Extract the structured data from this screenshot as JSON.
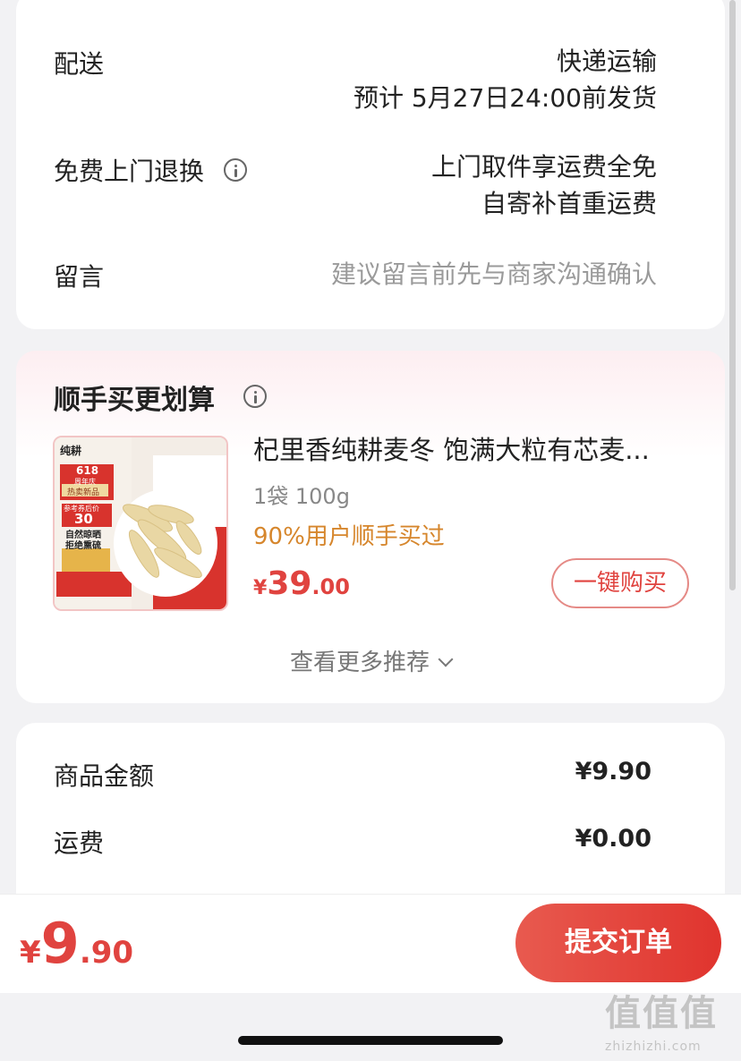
{
  "delivery": {
    "label": "配送",
    "method": "快递运输",
    "ship_time": "预计 5月27日24:00前发货"
  },
  "return_service": {
    "label": "免费上门退换",
    "line1": "上门取件享运费全免",
    "line2": "自寄补首重运费"
  },
  "message": {
    "label": "留言",
    "placeholder": "建议留言前先与商家沟通确认"
  },
  "recommend": {
    "title": "顺手买更划算",
    "product": {
      "name": "杞里香纯耕麦冬 饱满大粒有芯麦...",
      "spec": "1袋 100g",
      "note": "90%用户顺手买过",
      "price_symbol": "¥",
      "price_int": "39",
      "price_dec": ".00",
      "buy_label": "一键购买",
      "thumb_texts": {
        "brand": "纯耕",
        "badge_num": "618",
        "badge_sub": "周年庆",
        "tag": "热卖新品",
        "ref": "参考券后价",
        "ref_price": "30",
        "slogan1": "自然晾晒",
        "slogan2": "拒绝熏硫"
      }
    },
    "more_label": "查看更多推荐"
  },
  "summary": {
    "items": [
      {
        "label": "商品金额",
        "value": "¥9.90"
      },
      {
        "label": "运费",
        "value": "¥0.00"
      }
    ]
  },
  "bottom": {
    "currency": "¥",
    "total_int": "9",
    "total_dec": ".90",
    "submit_label": "提交订单"
  },
  "watermark": {
    "logo": "值值值",
    "url": "zhizhizhi.com"
  },
  "colors": {
    "accent": "#e0433f",
    "note": "#d6862c",
    "background": "#f2f2f4"
  }
}
